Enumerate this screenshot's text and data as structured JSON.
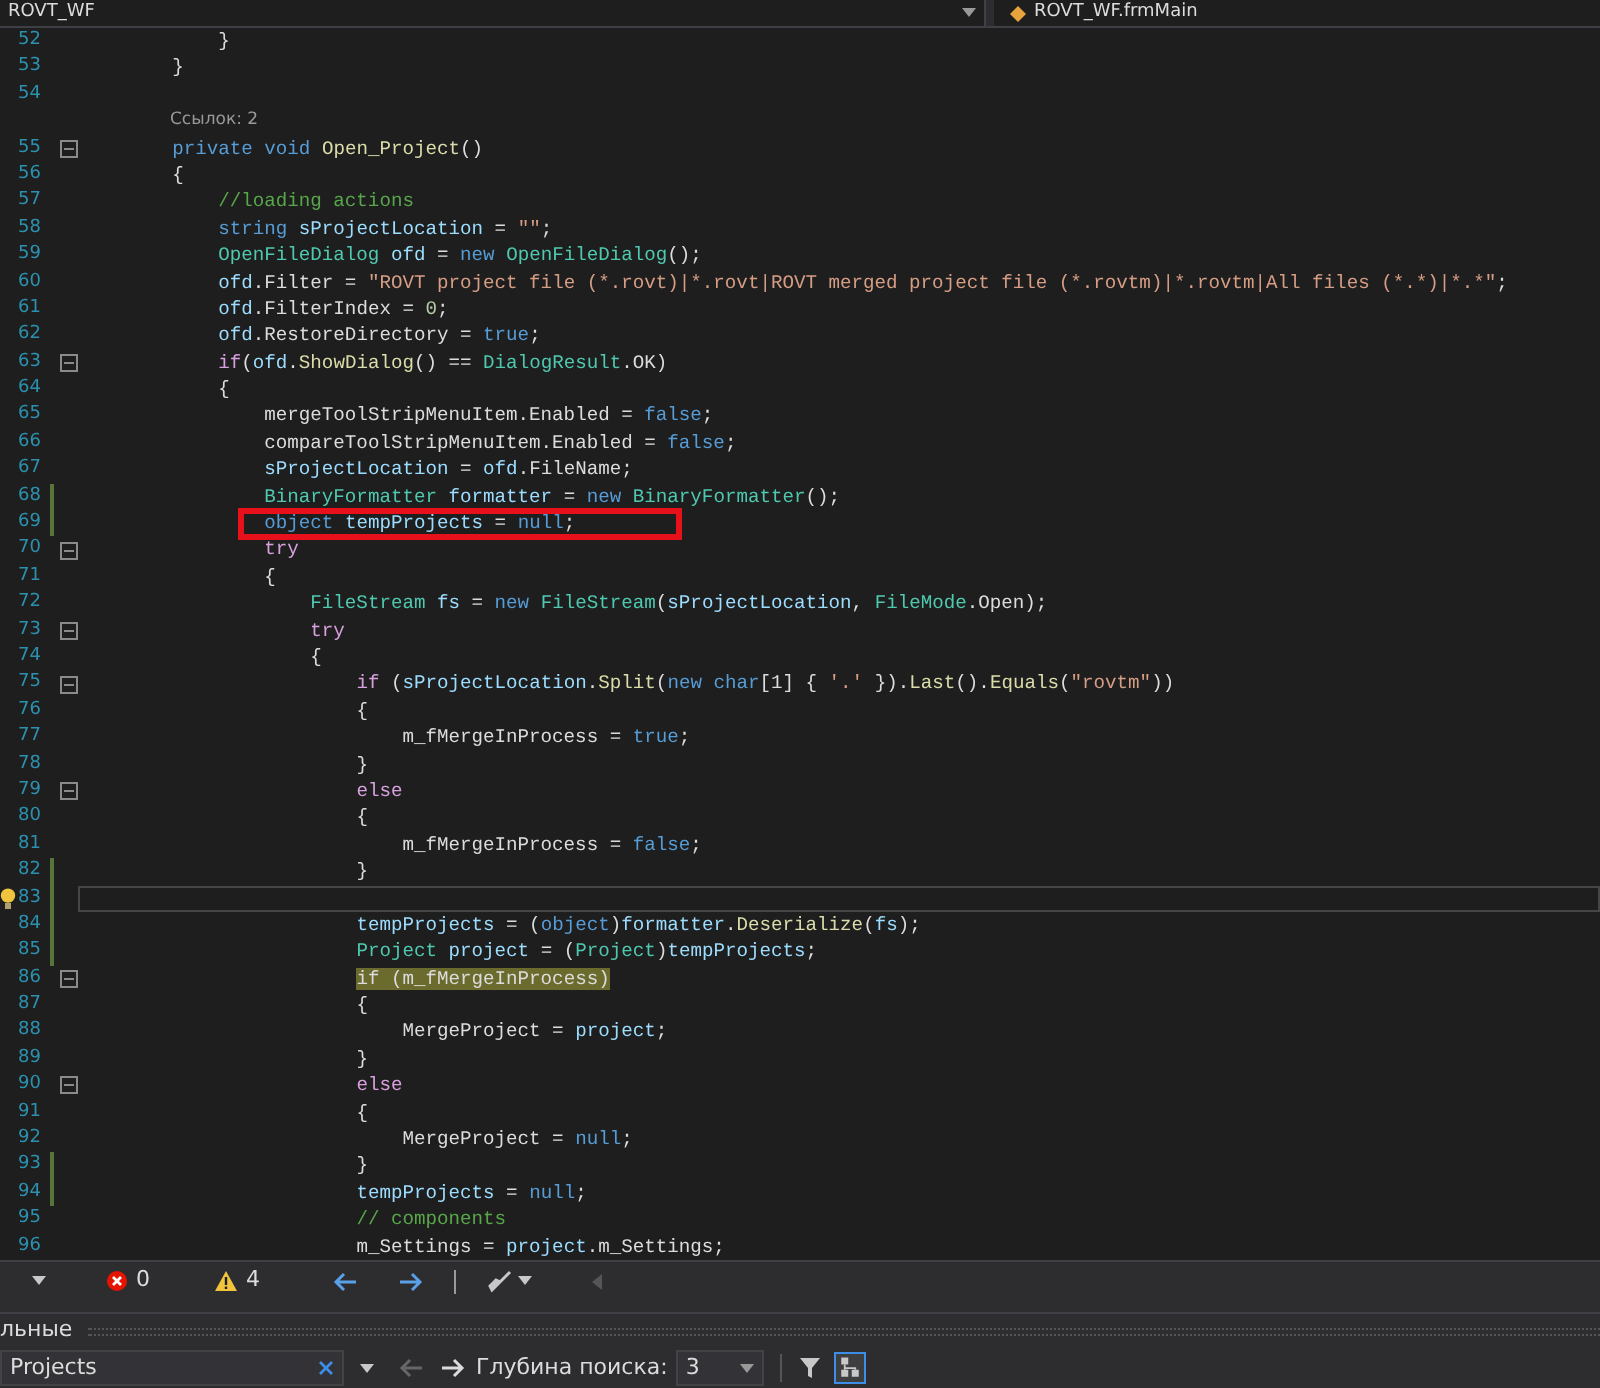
{
  "navbar": {
    "project": "ROVT_WF",
    "member": "ROVT_WF.frmMain"
  },
  "lines": [
    {
      "number": "52",
      "changed": false,
      "foldable": false,
      "current": false,
      "boxed": false,
      "tokens": [
        {
          "text": "            }",
          "kind": "plain"
        }
      ]
    },
    {
      "number": "53",
      "changed": false,
      "foldable": false,
      "current": false,
      "boxed": false,
      "tokens": [
        {
          "text": "        }",
          "kind": "plain"
        }
      ]
    },
    {
      "number": "54",
      "changed": false,
      "foldable": false,
      "current": false,
      "boxed": false
    },
    {
      "kind": "codelens",
      "text": "Ссылок: 2"
    },
    {
      "number": "55",
      "changed": false,
      "foldable": true,
      "current": false,
      "boxed": false,
      "tokens": [
        {
          "text": "        private",
          "kind": "keyword"
        },
        {
          "text": " void ",
          "kind": "keyword"
        },
        {
          "text": "Open_Project",
          "kind": "method"
        },
        {
          "text": "()",
          "kind": "plain"
        }
      ]
    },
    {
      "number": "56",
      "changed": false,
      "foldable": false,
      "current": false,
      "boxed": false,
      "tokens": [
        {
          "text": "        {",
          "kind": "plain"
        }
      ]
    },
    {
      "number": "57",
      "changed": false,
      "foldable": false,
      "current": false,
      "boxed": false,
      "tokens": [
        {
          "text": "            //loading actions",
          "kind": "comment"
        }
      ]
    },
    {
      "number": "58",
      "changed": false,
      "foldable": false,
      "current": false,
      "boxed": false,
      "tokens": [
        {
          "text": "            string",
          "kind": "keyword"
        },
        {
          "text": " sProjectLocation",
          "kind": "local"
        },
        {
          "text": " = ",
          "kind": "plain"
        },
        {
          "text": "\"\"",
          "kind": "string"
        },
        {
          "text": ";",
          "kind": "plain"
        }
      ]
    },
    {
      "number": "59",
      "changed": false,
      "foldable": false,
      "current": false,
      "boxed": false,
      "tokens": [
        {
          "text": "            OpenFileDialog",
          "kind": "type"
        },
        {
          "text": " ofd",
          "kind": "local"
        },
        {
          "text": " = ",
          "kind": "plain"
        },
        {
          "text": "new ",
          "kind": "keyword"
        },
        {
          "text": "OpenFileDialog",
          "kind": "type"
        },
        {
          "text": "();",
          "kind": "plain"
        }
      ]
    },
    {
      "number": "60",
      "changed": false,
      "foldable": false,
      "current": false,
      "boxed": false,
      "tokens": [
        {
          "text": "            ofd",
          "kind": "local"
        },
        {
          "text": ".Filter = ",
          "kind": "plain"
        },
        {
          "text": "\"ROVT project file (*.rovt)|*.rovt|ROVT merged project file (*.rovtm)|*.rovtm|All files (*.*)|*.*\"",
          "kind": "string"
        },
        {
          "text": ";",
          "kind": "plain"
        }
      ]
    },
    {
      "number": "61",
      "changed": false,
      "foldable": false,
      "current": false,
      "boxed": false,
      "tokens": [
        {
          "text": "            ofd",
          "kind": "local"
        },
        {
          "text": ".FilterIndex = ",
          "kind": "plain"
        },
        {
          "text": "0",
          "kind": "number"
        },
        {
          "text": ";",
          "kind": "plain"
        }
      ]
    },
    {
      "number": "62",
      "changed": false,
      "foldable": false,
      "current": false,
      "boxed": false,
      "tokens": [
        {
          "text": "            ofd",
          "kind": "local"
        },
        {
          "text": ".RestoreDirectory = ",
          "kind": "plain"
        },
        {
          "text": "true",
          "kind": "keyword"
        },
        {
          "text": ";",
          "kind": "plain"
        }
      ]
    },
    {
      "number": "63",
      "changed": false,
      "foldable": true,
      "current": false,
      "boxed": false,
      "tokens": [
        {
          "text": "            if",
          "kind": "control"
        },
        {
          "text": "(",
          "kind": "plain"
        },
        {
          "text": "ofd",
          "kind": "local"
        },
        {
          "text": ".",
          "kind": "plain"
        },
        {
          "text": "ShowDialog",
          "kind": "method"
        },
        {
          "text": "() == ",
          "kind": "plain"
        },
        {
          "text": "DialogResult",
          "kind": "type"
        },
        {
          "text": ".OK)",
          "kind": "plain"
        }
      ]
    },
    {
      "number": "64",
      "changed": false,
      "foldable": false,
      "current": false,
      "boxed": false,
      "tokens": [
        {
          "text": "            {",
          "kind": "plain"
        }
      ]
    },
    {
      "number": "65",
      "changed": false,
      "foldable": false,
      "current": false,
      "boxed": false,
      "tokens": [
        {
          "text": "                mergeToolStripMenuItem.Enabled = ",
          "kind": "plain"
        },
        {
          "text": "false",
          "kind": "keyword"
        },
        {
          "text": ";",
          "kind": "plain"
        }
      ]
    },
    {
      "number": "66",
      "changed": false,
      "foldable": false,
      "current": false,
      "boxed": false,
      "tokens": [
        {
          "text": "                compareToolStripMenuItem.Enabled = ",
          "kind": "plain"
        },
        {
          "text": "false",
          "kind": "keyword"
        },
        {
          "text": ";",
          "kind": "plain"
        }
      ]
    },
    {
      "number": "67",
      "changed": false,
      "foldable": false,
      "current": false,
      "boxed": false,
      "tokens": [
        {
          "text": "                sProjectLocation",
          "kind": "local"
        },
        {
          "text": " = ",
          "kind": "plain"
        },
        {
          "text": "ofd",
          "kind": "local"
        },
        {
          "text": ".FileName;",
          "kind": "plain"
        }
      ]
    },
    {
      "number": "68",
      "changed": true,
      "foldable": false,
      "current": false,
      "boxed": false,
      "tokens": [
        {
          "text": "                BinaryFormatter",
          "kind": "type"
        },
        {
          "text": " formatter",
          "kind": "local"
        },
        {
          "text": " = ",
          "kind": "plain"
        },
        {
          "text": "new ",
          "kind": "keyword"
        },
        {
          "text": "BinaryFormatter",
          "kind": "type"
        },
        {
          "text": "();",
          "kind": "plain"
        }
      ]
    },
    {
      "number": "69",
      "changed": true,
      "foldable": false,
      "current": false,
      "boxed": true,
      "tokens": [
        {
          "text": "                object",
          "kind": "keyword"
        },
        {
          "text": " tempProjects",
          "kind": "local"
        },
        {
          "text": " = ",
          "kind": "plain"
        },
        {
          "text": "null",
          "kind": "keyword"
        },
        {
          "text": ";",
          "kind": "plain"
        }
      ]
    },
    {
      "number": "70",
      "changed": false,
      "foldable": true,
      "current": false,
      "boxed": false,
      "tokens": [
        {
          "text": "                try",
          "kind": "control"
        }
      ]
    },
    {
      "number": "71",
      "changed": false,
      "foldable": false,
      "current": false,
      "boxed": false,
      "tokens": [
        {
          "text": "                {",
          "kind": "plain"
        }
      ]
    },
    {
      "number": "72",
      "changed": false,
      "foldable": false,
      "current": false,
      "boxed": false,
      "tokens": [
        {
          "text": "                    FileStream",
          "kind": "type"
        },
        {
          "text": " fs",
          "kind": "local"
        },
        {
          "text": " = ",
          "kind": "plain"
        },
        {
          "text": "new ",
          "kind": "keyword"
        },
        {
          "text": "FileStream",
          "kind": "type"
        },
        {
          "text": "(",
          "kind": "plain"
        },
        {
          "text": "sProjectLocation",
          "kind": "local"
        },
        {
          "text": ", ",
          "kind": "plain"
        },
        {
          "text": "FileMode",
          "kind": "type"
        },
        {
          "text": ".Open);",
          "kind": "plain"
        }
      ]
    },
    {
      "number": "73",
      "changed": false,
      "foldable": true,
      "current": false,
      "boxed": false,
      "tokens": [
        {
          "text": "                    try",
          "kind": "control"
        }
      ]
    },
    {
      "number": "74",
      "changed": false,
      "foldable": false,
      "current": false,
      "boxed": false,
      "tokens": [
        {
          "text": "                    {",
          "kind": "plain"
        }
      ]
    },
    {
      "number": "75",
      "changed": false,
      "foldable": true,
      "current": false,
      "boxed": false,
      "tokens": [
        {
          "text": "                        if",
          "kind": "control"
        },
        {
          "text": " (",
          "kind": "plain"
        },
        {
          "text": "sProjectLocation",
          "kind": "local"
        },
        {
          "text": ".",
          "kind": "plain"
        },
        {
          "text": "Split",
          "kind": "method"
        },
        {
          "text": "(",
          "kind": "plain"
        },
        {
          "text": "new char",
          "kind": "keyword"
        },
        {
          "text": "[1] { ",
          "kind": "plain"
        },
        {
          "text": "'.'",
          "kind": "string"
        },
        {
          "text": " }).",
          "kind": "plain"
        },
        {
          "text": "Last",
          "kind": "method"
        },
        {
          "text": "().",
          "kind": "plain"
        },
        {
          "text": "Equals",
          "kind": "method"
        },
        {
          "text": "(",
          "kind": "plain"
        },
        {
          "text": "\"rovtm\"",
          "kind": "string"
        },
        {
          "text": "))",
          "kind": "plain"
        }
      ]
    },
    {
      "number": "76",
      "changed": false,
      "foldable": false,
      "current": false,
      "boxed": false,
      "tokens": [
        {
          "text": "                        {",
          "kind": "plain"
        }
      ]
    },
    {
      "number": "77",
      "changed": false,
      "foldable": false,
      "current": false,
      "boxed": false,
      "tokens": [
        {
          "text": "                            m_fMergeInProcess = ",
          "kind": "plain"
        },
        {
          "text": "true",
          "kind": "keyword"
        },
        {
          "text": ";",
          "kind": "plain"
        }
      ]
    },
    {
      "number": "78",
      "changed": false,
      "foldable": false,
      "current": false,
      "boxed": false,
      "tokens": [
        {
          "text": "                        }",
          "kind": "plain"
        }
      ]
    },
    {
      "number": "79",
      "changed": false,
      "foldable": true,
      "current": false,
      "boxed": false,
      "tokens": [
        {
          "text": "                        else",
          "kind": "control"
        }
      ]
    },
    {
      "number": "80",
      "changed": false,
      "foldable": false,
      "current": false,
      "boxed": false,
      "tokens": [
        {
          "text": "                        {",
          "kind": "plain"
        }
      ]
    },
    {
      "number": "81",
      "changed": false,
      "foldable": false,
      "current": false,
      "boxed": false,
      "tokens": [
        {
          "text": "                            m_fMergeInProcess = ",
          "kind": "plain"
        },
        {
          "text": "false",
          "kind": "keyword"
        },
        {
          "text": ";",
          "kind": "plain"
        }
      ]
    },
    {
      "number": "82",
      "changed": true,
      "foldable": false,
      "current": false,
      "boxed": false,
      "tokens": [
        {
          "text": "                        }",
          "kind": "plain"
        }
      ]
    },
    {
      "number": "83",
      "changed": true,
      "foldable": false,
      "current": true,
      "boxed": false
    },
    {
      "number": "84",
      "changed": true,
      "foldable": false,
      "current": false,
      "boxed": false,
      "tokens": [
        {
          "text": "                        tempProjects",
          "kind": "local"
        },
        {
          "text": " = (",
          "kind": "plain"
        },
        {
          "text": "object",
          "kind": "keyword"
        },
        {
          "text": ")",
          "kind": "plain"
        },
        {
          "text": "formatter",
          "kind": "local"
        },
        {
          "text": ".",
          "kind": "plain"
        },
        {
          "text": "Deserialize",
          "kind": "method"
        },
        {
          "text": "(",
          "kind": "plain"
        },
        {
          "text": "fs",
          "kind": "local"
        },
        {
          "text": ");",
          "kind": "plain"
        }
      ]
    },
    {
      "number": "85",
      "changed": true,
      "foldable": false,
      "current": false,
      "boxed": false,
      "tokens": [
        {
          "text": "                        Project",
          "kind": "type"
        },
        {
          "text": " project",
          "kind": "local"
        },
        {
          "text": " = (",
          "kind": "plain"
        },
        {
          "text": "Project",
          "kind": "type"
        },
        {
          "text": ")",
          "kind": "plain"
        },
        {
          "text": "tempProjects",
          "kind": "local"
        },
        {
          "text": ";",
          "kind": "plain"
        }
      ]
    },
    {
      "number": "86",
      "changed": false,
      "foldable": true,
      "current": false,
      "boxed": false,
      "tokens": [
        {
          "text": "                        if (m_fMergeInProcess)",
          "kind": "match"
        }
      ]
    },
    {
      "number": "87",
      "changed": false,
      "foldable": false,
      "current": false,
      "boxed": false,
      "tokens": [
        {
          "text": "                        {",
          "kind": "plain"
        }
      ]
    },
    {
      "number": "88",
      "changed": false,
      "foldable": false,
      "current": false,
      "boxed": false,
      "tokens": [
        {
          "text": "                            MergeProject = ",
          "kind": "plain"
        },
        {
          "text": "project",
          "kind": "local"
        },
        {
          "text": ";",
          "kind": "plain"
        }
      ]
    },
    {
      "number": "89",
      "changed": false,
      "foldable": false,
      "current": false,
      "boxed": false,
      "tokens": [
        {
          "text": "                        }",
          "kind": "plain"
        }
      ]
    },
    {
      "number": "90",
      "changed": false,
      "foldable": true,
      "current": false,
      "boxed": false,
      "tokens": [
        {
          "text": "                        else",
          "kind": "control"
        }
      ]
    },
    {
      "number": "91",
      "changed": false,
      "foldable": false,
      "current": false,
      "boxed": false,
      "tokens": [
        {
          "text": "                        {",
          "kind": "plain"
        }
      ]
    },
    {
      "number": "92",
      "changed": false,
      "foldable": false,
      "current": false,
      "boxed": false,
      "tokens": [
        {
          "text": "                            MergeProject = ",
          "kind": "plain"
        },
        {
          "text": "null",
          "kind": "keyword"
        },
        {
          "text": ";",
          "kind": "plain"
        }
      ]
    },
    {
      "number": "93",
      "changed": true,
      "foldable": false,
      "current": false,
      "boxed": false,
      "tokens": [
        {
          "text": "                        }",
          "kind": "plain"
        }
      ]
    },
    {
      "number": "94",
      "changed": true,
      "foldable": false,
      "current": false,
      "boxed": false,
      "tokens": [
        {
          "text": "                        tempProjects",
          "kind": "local"
        },
        {
          "text": " = ",
          "kind": "plain"
        },
        {
          "text": "null",
          "kind": "keyword"
        },
        {
          "text": ";",
          "kind": "plain"
        }
      ]
    },
    {
      "number": "95",
      "changed": false,
      "foldable": false,
      "current": false,
      "boxed": false,
      "tokens": [
        {
          "text": "                        // components",
          "kind": "comment"
        }
      ]
    },
    {
      "number": "96",
      "changed": false,
      "foldable": false,
      "current": false,
      "boxed": false,
      "tokens": [
        {
          "text": "                        m_Settings = ",
          "kind": "plain"
        },
        {
          "text": "project",
          "kind": "local"
        },
        {
          "text": ".m_Settings;",
          "kind": "plain"
        }
      ]
    }
  ],
  "status": {
    "errors": "0",
    "warnings": "4"
  },
  "panel": {
    "title": "льные",
    "search_value": "Projects",
    "depth_label": "Глубина поиска:",
    "depth_value": "3"
  }
}
